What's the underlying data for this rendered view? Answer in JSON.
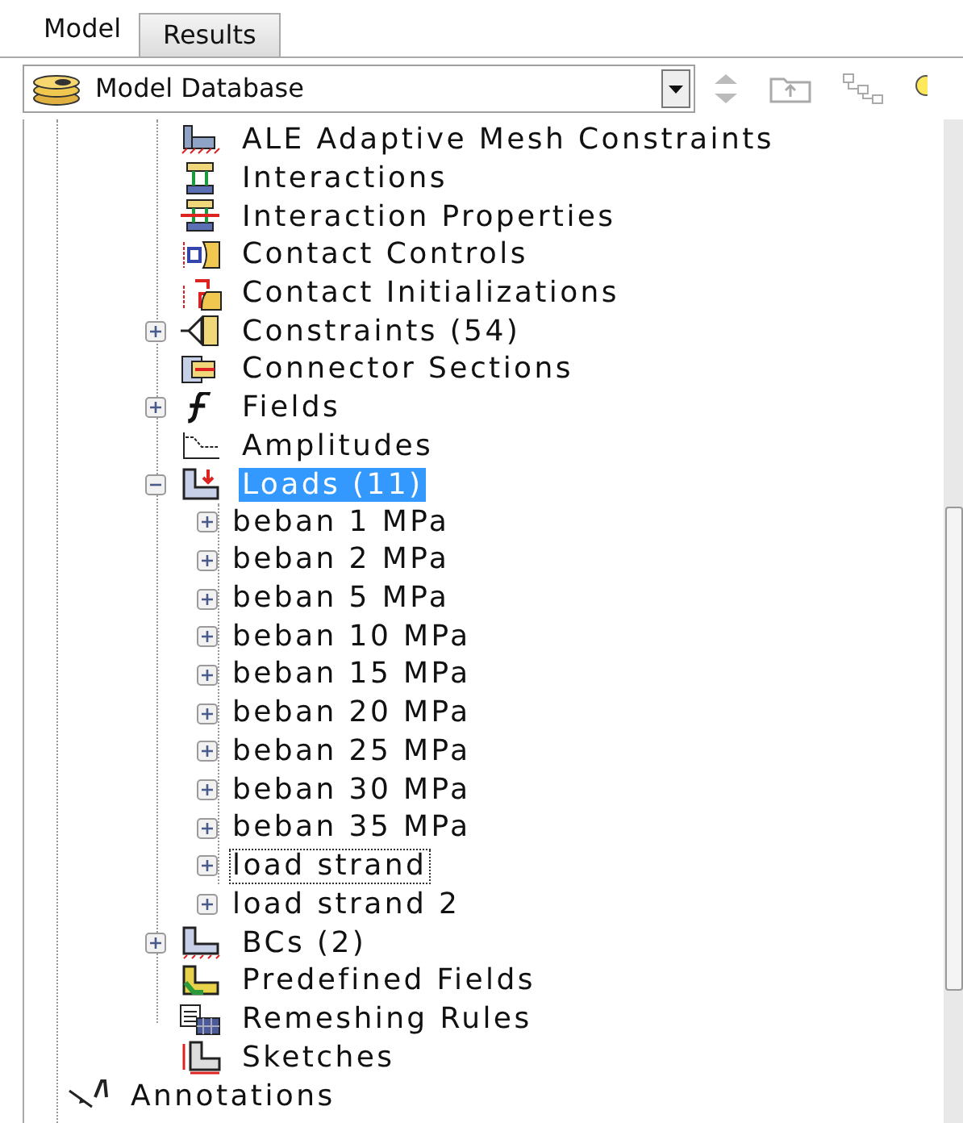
{
  "tabs": [
    {
      "label": "Model",
      "selected": true
    },
    {
      "label": "Results",
      "selected": false
    }
  ],
  "model_selector": {
    "value": "Model Database"
  },
  "tree": {
    "model_children": [
      {
        "label": "ALE Adaptive Mesh Constraints",
        "kind": "ale",
        "expandable": false,
        "selected": false
      },
      {
        "label": "Interactions",
        "kind": "interaction",
        "expandable": false,
        "selected": false
      },
      {
        "label": "Interaction Properties",
        "kind": "interaction-prop",
        "expandable": false,
        "selected": false
      },
      {
        "label": "Contact Controls",
        "kind": "contact-control",
        "expandable": false,
        "selected": false
      },
      {
        "label": "Contact Initializations",
        "kind": "contact-init",
        "expandable": false,
        "selected": false
      },
      {
        "label": "Constraints (54)",
        "kind": "constraint",
        "expandable": true,
        "expanded": false,
        "selected": false
      },
      {
        "label": "Connector Sections",
        "kind": "connector",
        "expandable": false,
        "selected": false
      },
      {
        "label": "Fields",
        "kind": "field",
        "expandable": true,
        "expanded": false,
        "selected": false
      },
      {
        "label": "Amplitudes",
        "kind": "amplitude",
        "expandable": false,
        "selected": false
      },
      {
        "label": "Loads (11)",
        "kind": "load",
        "expandable": true,
        "expanded": true,
        "selected": true,
        "children": [
          {
            "label": "beban 1 MPa",
            "focused": false
          },
          {
            "label": "beban 2 MPa",
            "focused": false
          },
          {
            "label": "beban 5 MPa",
            "focused": false
          },
          {
            "label": "beban 10 MPa",
            "focused": false
          },
          {
            "label": "beban 15 MPa",
            "focused": false
          },
          {
            "label": "beban 20 MPa",
            "focused": false
          },
          {
            "label": "beban 25 MPa",
            "focused": false
          },
          {
            "label": "beban 30 MPa",
            "focused": false
          },
          {
            "label": "beban 35 MPa",
            "focused": false
          },
          {
            "label": "load strand",
            "focused": true
          },
          {
            "label": "load strand 2",
            "focused": false
          }
        ]
      },
      {
        "label": "BCs (2)",
        "kind": "bc",
        "expandable": true,
        "expanded": false,
        "selected": false
      },
      {
        "label": "Predefined Fields",
        "kind": "predefined",
        "expandable": false,
        "selected": false
      },
      {
        "label": "Remeshing Rules",
        "kind": "remesh",
        "expandable": false,
        "selected": false
      },
      {
        "label": "Sketches",
        "kind": "sketch",
        "expandable": false,
        "selected": false
      }
    ],
    "root_items": [
      {
        "label": "Annotations",
        "kind": "annotation",
        "expandable": false,
        "selected": false
      }
    ]
  }
}
